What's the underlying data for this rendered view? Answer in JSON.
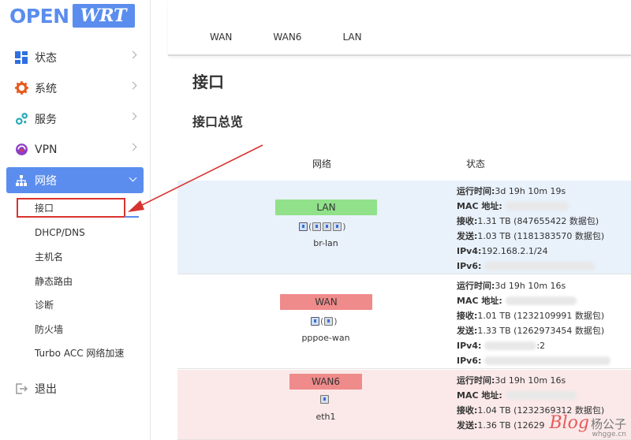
{
  "logo": {
    "open": "OPEN",
    "wrt": "WRT"
  },
  "sidebar": {
    "items": [
      {
        "label": "状态"
      },
      {
        "label": "系统"
      },
      {
        "label": "服务"
      },
      {
        "label": "VPN"
      },
      {
        "label": "网络"
      }
    ],
    "network_sub": [
      {
        "label": "接口"
      },
      {
        "label": "DHCP/DNS"
      },
      {
        "label": "主机名"
      },
      {
        "label": "静态路由"
      },
      {
        "label": "诊断"
      },
      {
        "label": "防火墙"
      },
      {
        "label": "Turbo ACC 网络加速"
      }
    ],
    "logout": "退出"
  },
  "tabs": [
    "WAN",
    "WAN6",
    "LAN"
  ],
  "page": {
    "title": "接口",
    "section": "接口总览",
    "col_network": "网络",
    "col_status": "状态"
  },
  "interfaces": [
    {
      "badge": "LAN",
      "device": "br-lan",
      "icon_prefix": "",
      "status": {
        "uptime_label": "运行时间:",
        "uptime": "3d 19h 10m 19s",
        "mac_label": "MAC 地址:",
        "rx_label": "接收:",
        "rx": "1.31 TB (847655422 数据包)",
        "tx_label": "发送:",
        "tx": "1.03 TB (1181383570 数据包)",
        "ipv4_label": "IPv4:",
        "ipv4": "192.168.2.1/24",
        "ipv6_label": "IPv6:"
      }
    },
    {
      "badge": "WAN",
      "device": "pppoe-wan",
      "status": {
        "uptime_label": "运行时间:",
        "uptime": "3d 19h 10m 16s",
        "mac_label": "MAC 地址:",
        "rx_label": "接收:",
        "rx": "1.01 TB (1232109991 数据包)",
        "tx_label": "发送:",
        "tx": "1.33 TB (1262973454 数据包)",
        "ipv4_label": "IPv4:",
        "ipv4_tail": ":2",
        "ipv6_label": "IPv6:"
      }
    },
    {
      "badge": "WAN6",
      "device": "eth1",
      "status": {
        "uptime_label": "运行时间:",
        "uptime": "3d 19h 10m 16s",
        "mac_label": "MAC 地址:",
        "rx_label": "接收:",
        "rx": "1.04 TB (1232369312 数据包)",
        "tx_label": "发送:",
        "tx": "1.36 TB (12629"
      }
    }
  ],
  "watermark": {
    "blog": "Blog",
    "name": "杨公子",
    "url": "whgge.cn"
  },
  "colors": {
    "accent": "#5b8dee",
    "lan_badge": "#90e18a",
    "wan_badge": "#ef8b8b",
    "lan_row": "#e9f1fb",
    "wan6_row": "#fbe9e9",
    "annotation": "#d9332f"
  }
}
